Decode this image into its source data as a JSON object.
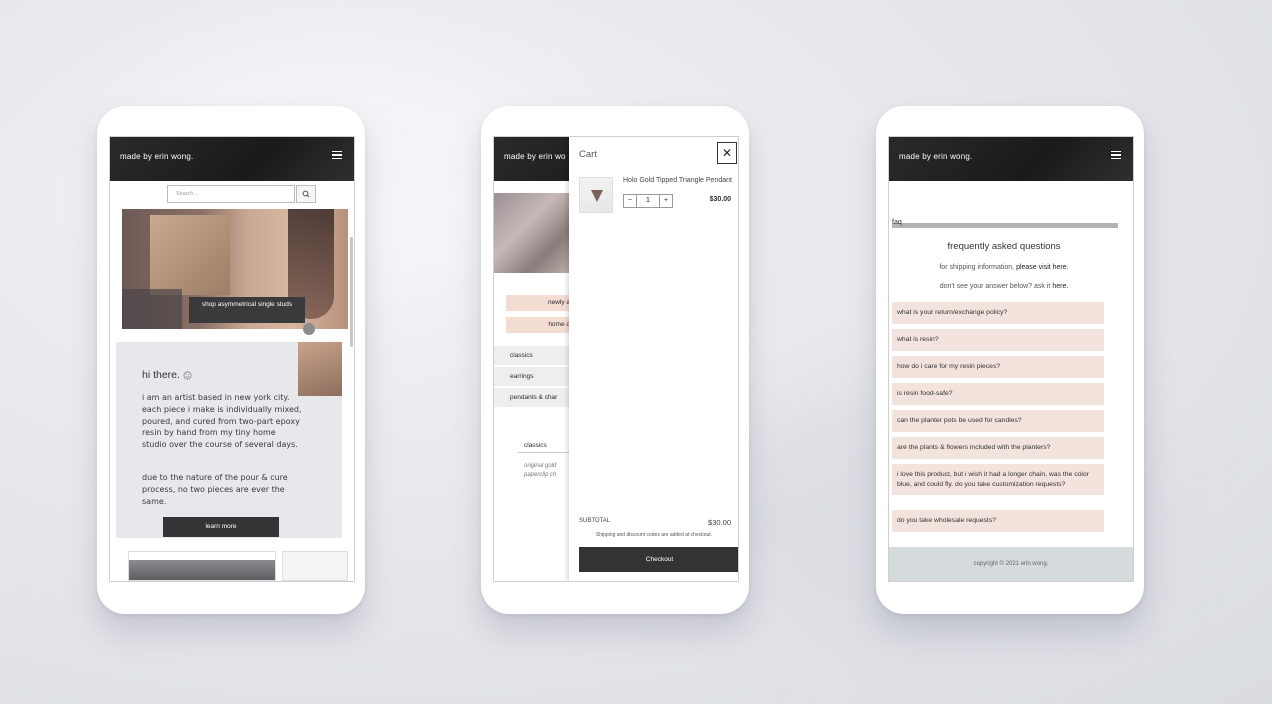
{
  "phone1": {
    "brand": "made by erin wong.",
    "search_placeholder": "Search...",
    "hero_button": "shop asymmetrical single studs",
    "greeting": "hi there.",
    "paragraph1": "i am an artist based in new york city. each piece i make is individually mixed, poured, and cured from two-part epoxy resin by hand from my tiny home studio over the course of several days.",
    "paragraph2": "due to the nature of the pour & cure process, no two pieces are ever the same.",
    "learn_more": "learn more"
  },
  "phone2": {
    "brand": "made by erin wo",
    "pink_buttons": [
      "newly a",
      "home d"
    ],
    "categories": [
      "classics",
      "earrings",
      "pendants & char"
    ],
    "tab": "classics",
    "italic_text": "original gold paperclip ch",
    "cart": {
      "title": "Cart",
      "close": "✕",
      "product_name": "Holo Gold Tipped Triangle Pendant",
      "qty_minus": "−",
      "qty_value": "1",
      "qty_plus": "+",
      "price": "$30.00",
      "subtotal_label": "SUBTOTAL",
      "subtotal_value": "$30.00",
      "shipping_note": "Shipping and discount codes are added at checkout.",
      "checkout": "Checkout"
    }
  },
  "phone3": {
    "brand": "made by erin wong.",
    "faq_label": "faq",
    "title": "frequently asked questions",
    "shipping_info_prefix": "for shipping information,",
    "shipping_info_link": "please visit here.",
    "ask_prefix": "don't see your answer below? ask it",
    "ask_link": "here.",
    "questions": [
      "what is your return/exchange policy?",
      "what is resin?",
      "how do i care for my resin pieces?",
      "is resin food-safe?",
      "can the planter pots be used for candles?",
      "are the plants & flowers included with the planters?",
      "i love this product, but i wish it had a longer chain, was the color blue, and could fly. do you take customization requests?",
      "do you take wholesale requests?"
    ],
    "footer": "copyright © 2021 erin wong."
  },
  "icons": [
    "hamburger-menu-icon",
    "search-icon",
    "close-icon",
    "smiley-icon"
  ]
}
